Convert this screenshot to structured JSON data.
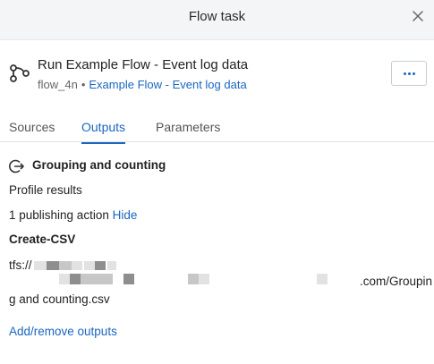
{
  "header": {
    "title": "Flow task"
  },
  "icons": {
    "close": "close-icon",
    "flow": "flow-icon",
    "more": "more-icon",
    "output": "output-arrow-icon"
  },
  "flow": {
    "name": "Run Example Flow - Event log data",
    "id": "flow_4n",
    "separator": "•",
    "link": "Example Flow - Event log data"
  },
  "tabs": [
    {
      "label": "Sources",
      "active": false
    },
    {
      "label": "Outputs",
      "active": true
    },
    {
      "label": "Parameters",
      "active": false
    }
  ],
  "output": {
    "title": "Grouping and counting",
    "profile": "Profile results",
    "publishing_text": "1 publishing action",
    "hide_label": "Hide",
    "action_name": "Create-CSV",
    "path_prefix": "tfs://",
    "path_suffix": ".com/Groupin",
    "path_line2": "g and counting.csv"
  },
  "footer": {
    "add_remove_label": "Add/remove outputs"
  },
  "colors": {
    "accent": "#1a66c2",
    "header_bg": "#f4f5f7",
    "text": "#222222"
  }
}
